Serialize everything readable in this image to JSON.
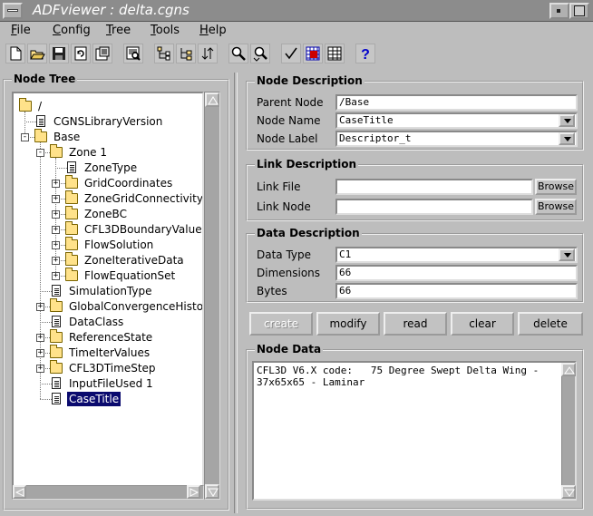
{
  "window": {
    "title": "ADFviewer : delta.cgns"
  },
  "menu": [
    {
      "label": "File",
      "key": "F",
      "rest": "ile"
    },
    {
      "label": "Config",
      "key": "C",
      "rest": "onfig"
    },
    {
      "label": "Tree",
      "key": "T",
      "rest": "ree"
    },
    {
      "label": "Tools",
      "key": "T",
      "rest": "ools"
    },
    {
      "label": "Help",
      "key": "H",
      "rest": "elp"
    }
  ],
  "toolbar": [
    {
      "name": "new-file-icon"
    },
    {
      "name": "open-folder-icon"
    },
    {
      "name": "save-icon"
    },
    {
      "name": "refresh-icon"
    },
    {
      "name": "properties-icon"
    },
    {
      "name": "view-icon"
    },
    {
      "name": "link-tree-icon"
    },
    {
      "name": "sort-tree-icon"
    },
    {
      "name": "sort-icon"
    },
    {
      "name": "find-icon"
    },
    {
      "name": "find-next-icon"
    },
    {
      "name": "check-icon"
    },
    {
      "name": "grid-icon"
    },
    {
      "name": "table-icon"
    },
    {
      "name": "help-icon"
    }
  ],
  "tree": {
    "title": "Node Tree",
    "nodes": [
      {
        "label": "/",
        "type": "folder",
        "depth": 0,
        "expander": ""
      },
      {
        "label": "CGNSLibraryVersion",
        "type": "doc",
        "depth": 1,
        "expander": ""
      },
      {
        "label": "Base",
        "type": "folder",
        "depth": 1,
        "expander": "-"
      },
      {
        "label": "Zone    1",
        "type": "folder",
        "depth": 2,
        "expander": "-"
      },
      {
        "label": "ZoneType",
        "type": "doc",
        "depth": 3,
        "expander": ""
      },
      {
        "label": "GridCoordinates",
        "type": "folder",
        "depth": 3,
        "expander": "+"
      },
      {
        "label": "ZoneGridConnectivity",
        "type": "folder",
        "depth": 3,
        "expander": "+"
      },
      {
        "label": "ZoneBC",
        "type": "folder",
        "depth": 3,
        "expander": "+"
      },
      {
        "label": "CFL3DBoundaryValue",
        "type": "folder",
        "depth": 3,
        "expander": "+"
      },
      {
        "label": "FlowSolution",
        "type": "folder",
        "depth": 3,
        "expander": "+"
      },
      {
        "label": "ZoneIterativeData",
        "type": "folder",
        "depth": 3,
        "expander": "+"
      },
      {
        "label": "FlowEquationSet",
        "type": "folder",
        "depth": 3,
        "expander": "+"
      },
      {
        "label": "SimulationType",
        "type": "doc",
        "depth": 2,
        "expander": ""
      },
      {
        "label": "GlobalConvergenceHistor",
        "type": "folder",
        "depth": 2,
        "expander": "+"
      },
      {
        "label": "DataClass",
        "type": "doc",
        "depth": 2,
        "expander": ""
      },
      {
        "label": "ReferenceState",
        "type": "folder",
        "depth": 2,
        "expander": "+"
      },
      {
        "label": "TimeIterValues",
        "type": "folder",
        "depth": 2,
        "expander": "+"
      },
      {
        "label": "CFL3DTimeStep",
        "type": "folder",
        "depth": 2,
        "expander": "+"
      },
      {
        "label": "InputFileUsed 1",
        "type": "doc",
        "depth": 2,
        "expander": ""
      },
      {
        "label": "CaseTitle",
        "type": "doc",
        "depth": 2,
        "expander": "",
        "selected": true
      }
    ]
  },
  "node_description": {
    "title": "Node Description",
    "parent_label": "Parent Node",
    "parent_value": "/Base",
    "name_label": "Node Name",
    "name_value": "CaseTitle",
    "nodelabel_label": "Node Label",
    "nodelabel_value": "Descriptor_t"
  },
  "link_description": {
    "title": "Link Description",
    "file_label": "Link File",
    "file_value": "",
    "node_label": "Link Node",
    "node_value": "",
    "browse": "Browse"
  },
  "data_description": {
    "title": "Data Description",
    "type_label": "Data Type",
    "type_value": "C1",
    "dim_label": "Dimensions",
    "dim_value": "66",
    "bytes_label": "Bytes",
    "bytes_value": "66"
  },
  "actions": {
    "create": "create",
    "modify": "modify",
    "read": "read",
    "clear": "clear",
    "delete": "delete"
  },
  "node_data": {
    "title": "Node Data",
    "text": "CFL3D V6.X code:   75 Degree Swept Delta Wing -\n37x65x65 - Laminar"
  }
}
